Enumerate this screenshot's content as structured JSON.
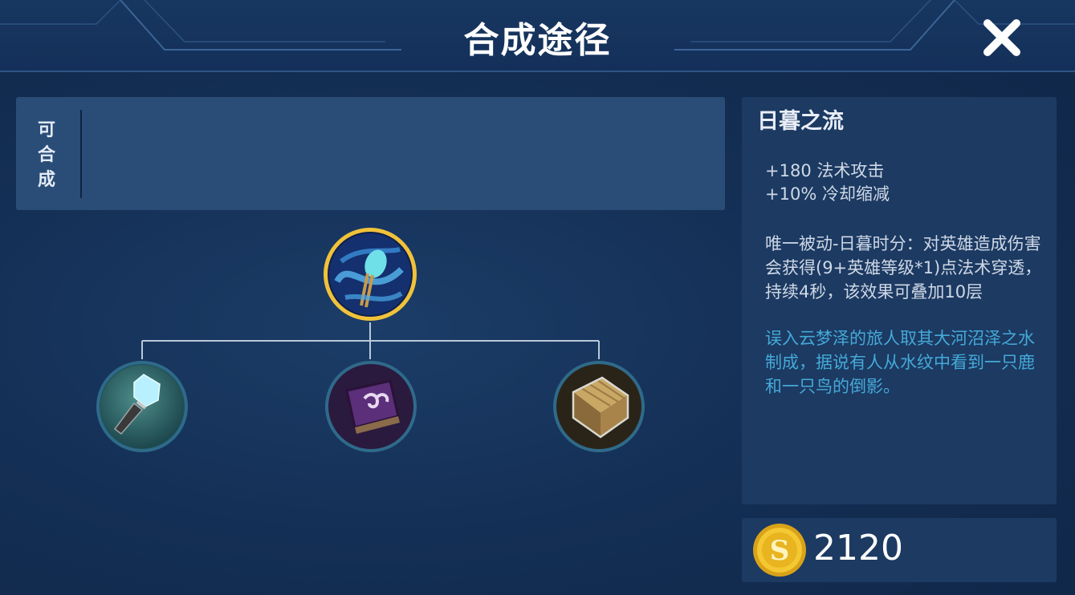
{
  "header": {
    "title": "合成途径"
  },
  "compose": {
    "label": [
      "可",
      "合",
      "成"
    ]
  },
  "tree": {
    "root": {
      "icon": "sunset-flow-item-icon"
    },
    "children": [
      {
        "icon": "crystal-wand-item-icon"
      },
      {
        "icon": "spellbook-item-icon"
      },
      {
        "icon": "wooden-chest-item-icon"
      }
    ]
  },
  "info": {
    "name": "日暮之流",
    "stats": [
      "+180 法术攻击",
      "+10% 冷却缩减"
    ],
    "passive": "唯一被动-日暮时分：对英雄造成伤害会获得(9+英雄等级*1)点法术穿透，持续4秒，该效果可叠加10层",
    "lore": "误入云梦泽的旅人取其大河沼泽之水制成，据说有人从水纹中看到一只鹿和一只鸟的倒影。"
  },
  "price": {
    "value": "2120",
    "icon": "gold-coin-icon"
  },
  "colors": {
    "accent_gold": "#f0c23a",
    "lore_blue": "#45a9d8",
    "panel": "#2a4d78"
  }
}
